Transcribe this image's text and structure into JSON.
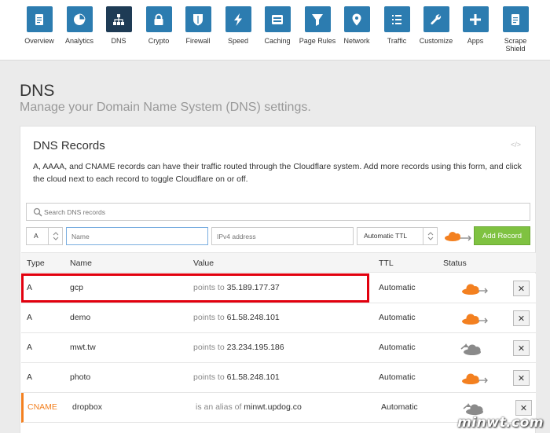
{
  "nav": [
    {
      "label": "Overview",
      "icon": "document-icon"
    },
    {
      "label": "Analytics",
      "icon": "pie-chart-icon"
    },
    {
      "label": "DNS",
      "icon": "network-tree-icon",
      "active": true
    },
    {
      "label": "Crypto",
      "icon": "lock-icon"
    },
    {
      "label": "Firewall",
      "icon": "shield-icon"
    },
    {
      "label": "Speed",
      "icon": "lightning-icon"
    },
    {
      "label": "Caching",
      "icon": "server-icon"
    },
    {
      "label": "Page Rules",
      "icon": "filter-icon"
    },
    {
      "label": "Network",
      "icon": "location-pin-icon"
    },
    {
      "label": "Traffic",
      "icon": "list-icon"
    },
    {
      "label": "Customize",
      "icon": "wrench-icon"
    },
    {
      "label": "Apps",
      "icon": "plus-icon"
    },
    {
      "label": "Scrape Shield",
      "icon": "document-icon"
    }
  ],
  "page": {
    "title": "DNS",
    "subtitle": "Manage your Domain Name System (DNS) settings."
  },
  "card": {
    "title": "DNS Records",
    "description": "A, AAAA, and CNAME records can have their traffic routed through the Cloudflare system. Add more records using this form, and click the cloud next to each record to toggle Cloudflare on or off."
  },
  "search": {
    "placeholder": "Search DNS records"
  },
  "form": {
    "type_value": "A",
    "name_placeholder": "Name",
    "ip_placeholder": "IPv4 address",
    "ttl_value": "Automatic TTL",
    "add_label": "Add Record"
  },
  "table": {
    "headers": {
      "type": "Type",
      "name": "Name",
      "value": "Value",
      "ttl": "TTL",
      "status": "Status"
    },
    "rows": [
      {
        "type": "A",
        "name": "gcp",
        "value_prefix": "points to",
        "value": "35.189.177.37",
        "ttl": "Automatic",
        "proxied": true
      },
      {
        "type": "A",
        "name": "demo",
        "value_prefix": "points to",
        "value": "61.58.248.101",
        "ttl": "Automatic",
        "proxied": true
      },
      {
        "type": "A",
        "name": "mwt.tw",
        "value_prefix": "points to",
        "value": "23.234.195.186",
        "ttl": "Automatic",
        "proxied": false
      },
      {
        "type": "A",
        "name": "photo",
        "value_prefix": "points to",
        "value": "61.58.248.101",
        "ttl": "Automatic",
        "proxied": true
      },
      {
        "type": "CNAME",
        "name": "dropbox",
        "value_prefix": "is an alias of",
        "value": "minwt.updog.co",
        "ttl": "Automatic",
        "proxied": false
      }
    ],
    "delete_symbol": "✕"
  },
  "colors": {
    "accent": "#2c7cb0",
    "active": "#1e3b55",
    "cloud_on": "#f38020",
    "cloud_off": "#8a8a8a",
    "add": "#7fc241",
    "highlight": "#e2000e"
  },
  "watermark": "minwt.com"
}
